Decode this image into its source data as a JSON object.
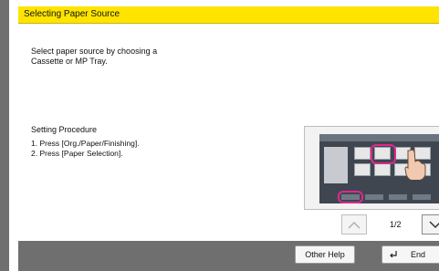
{
  "header": {
    "title": "Selecting Paper Source"
  },
  "description": "Select paper source by choosing a\nCassette or MP Tray.",
  "procedure": {
    "heading": "Setting Procedure",
    "steps": [
      "1. Press [Org./Paper/Finishing].",
      "2. Press [Paper Selection]."
    ]
  },
  "pager": {
    "indicator": "1/2",
    "up_icon": "chevron-up-icon",
    "down_icon": "chevron-down-icon"
  },
  "footer": {
    "help_label": "Other Help",
    "end_label": "End",
    "end_icon": "return-arrow-icon"
  },
  "colors": {
    "title_bar": "#ffe400",
    "highlight": "#e0288d",
    "frame": "#6f6f6f"
  }
}
